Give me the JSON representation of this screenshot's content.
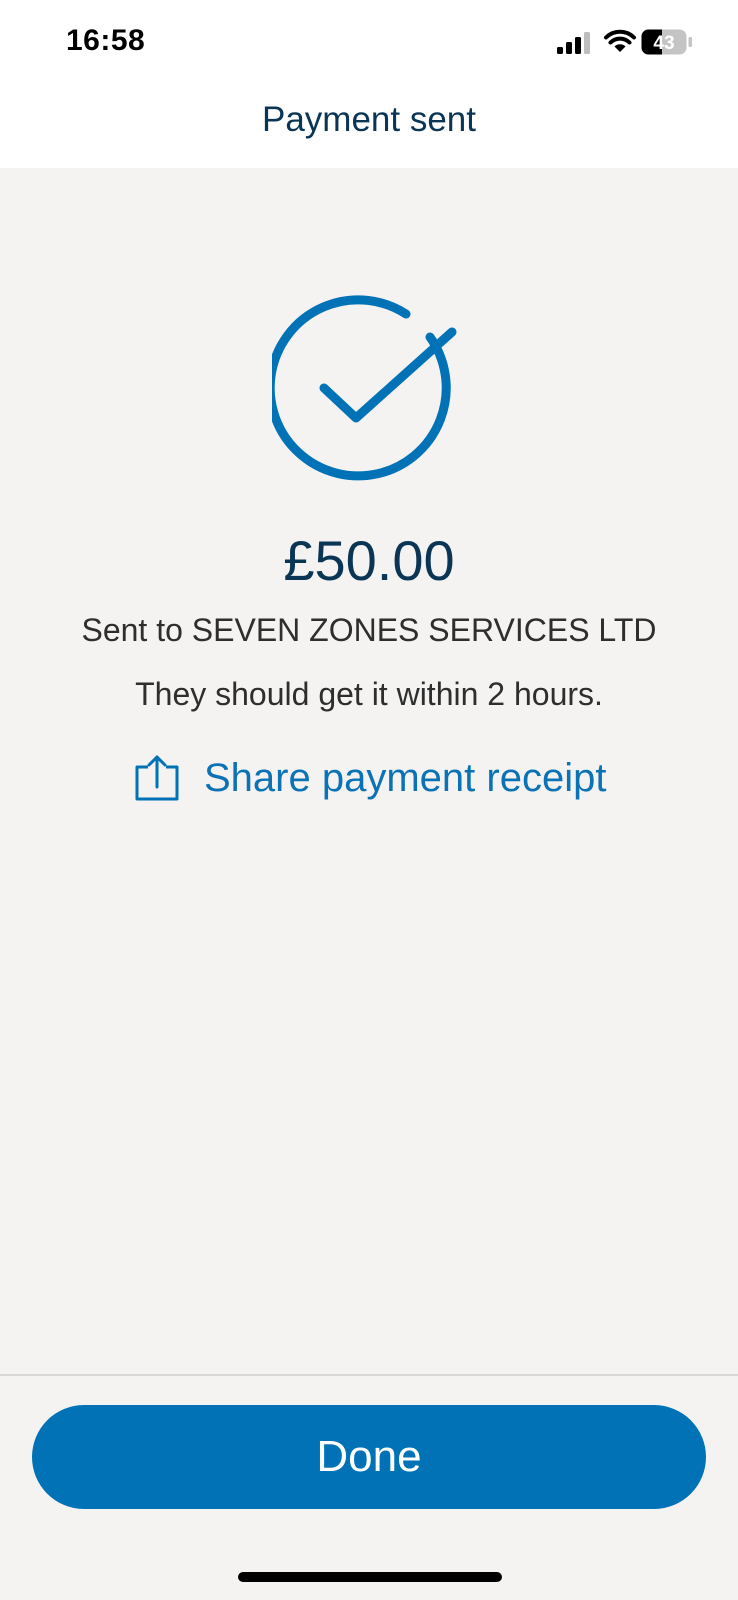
{
  "status_bar": {
    "time": "16:58",
    "battery_level": "43",
    "icons": [
      "cellular-signal-icon",
      "wifi-icon",
      "battery-icon"
    ]
  },
  "header": {
    "title": "Payment sent"
  },
  "confirmation": {
    "icon": "check-circle-icon",
    "amount": "£50.00",
    "recipient_text": "Sent to SEVEN ZONES SERVICES LTD",
    "eta_text": "They should get it within 2 hours.",
    "share": {
      "icon": "share-icon",
      "label": "Share payment receipt"
    }
  },
  "footer": {
    "done_label": "Done"
  },
  "colors": {
    "accent": "#0072b5",
    "title_text": "#0b3554",
    "body_text": "#2e2e2e",
    "background": "#f4f3f2",
    "header_background": "#ffffff"
  }
}
